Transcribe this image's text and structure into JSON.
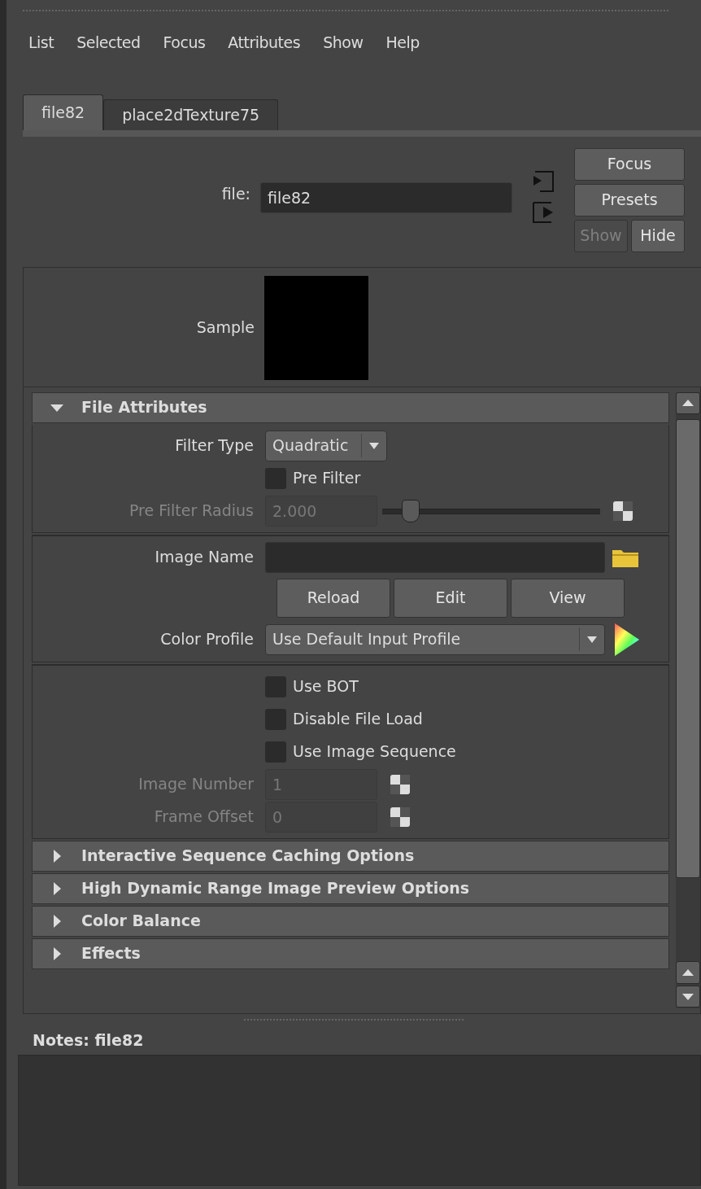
{
  "menu": [
    "List",
    "Selected",
    "Focus",
    "Attributes",
    "Show",
    "Help"
  ],
  "tabs": [
    {
      "label": "file82",
      "selected": true
    },
    {
      "label": "place2dTexture75",
      "selected": false
    }
  ],
  "node": {
    "label": "file:",
    "value": "file82"
  },
  "side_buttons": [
    {
      "label": "Focus",
      "disabled": false
    },
    {
      "label": "Presets",
      "disabled": false
    },
    {
      "label": "Show",
      "disabled": true
    },
    {
      "label": "Hide",
      "disabled": false
    }
  ],
  "sample": {
    "label": "Sample"
  },
  "sections": [
    {
      "title": "File Attributes",
      "expanded": true,
      "groups": [
        [
          {
            "kind": "dropdown",
            "label": "Filter Type",
            "value": "Quadratic",
            "disabled": false
          },
          {
            "kind": "checkbox",
            "label": "Pre Filter",
            "checked": false
          },
          {
            "kind": "slider",
            "label": "Pre Filter Radius",
            "value": "2.000",
            "level": 0.13,
            "disabled": true
          }
        ],
        [
          {
            "kind": "file",
            "label": "Image Name"
          },
          {
            "kind": "buttons",
            "buttons": [
              "Reload",
              "Edit",
              "View"
            ]
          },
          {
            "kind": "profile",
            "label": "Color Profile",
            "value": "Use Default Input Profile",
            "disabled": false
          }
        ],
        [
          {
            "kind": "checkbox",
            "label": "Use BOT",
            "checked": false
          },
          {
            "kind": "checkbox",
            "label": "Disable File Load",
            "checked": false
          },
          {
            "kind": "checkbox",
            "label": "Use Image Sequence",
            "checked": false
          },
          {
            "kind": "number",
            "label": "Image Number",
            "value": "1",
            "disabled": true
          },
          {
            "kind": "number",
            "label": "Frame Offset",
            "value": "0",
            "disabled": true
          }
        ]
      ]
    },
    {
      "title": "Interactive Sequence Caching Options",
      "expanded": false
    },
    {
      "title": "High Dynamic Range Image Preview Options",
      "expanded": false
    },
    {
      "title": "Color Balance",
      "expanded": false
    },
    {
      "title": "Effects",
      "expanded": false
    }
  ],
  "notes": {
    "label": "Notes: file82"
  }
}
